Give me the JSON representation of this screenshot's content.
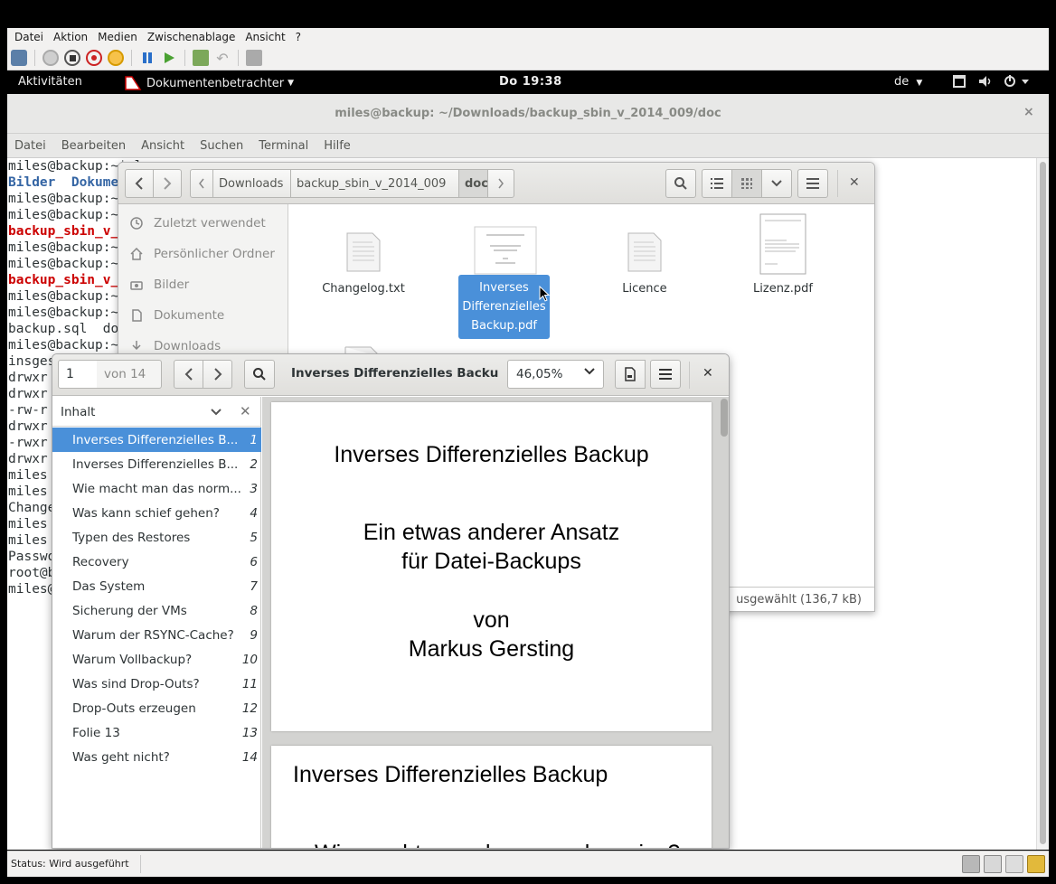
{
  "vbox": {
    "menu": [
      "Datei",
      "Aktion",
      "Medien",
      "Zwischenablage",
      "Ansicht",
      "?"
    ],
    "status": "Status: Wird ausgeführt"
  },
  "gnome": {
    "activities": "Aktivitäten",
    "app_menu": "Dokumentenbetrachter",
    "clock": "Do 19:38",
    "lang": "de"
  },
  "terminal": {
    "title": "miles@backup: ~/Downloads/backup_sbin_v_2014_009/doc",
    "close": "×",
    "menu": [
      "Datei",
      "Bearbeiten",
      "Ansicht",
      "Suchen",
      "Terminal",
      "Hilfe"
    ],
    "lines": [
      {
        "t": "miles@backup:~$ ls",
        "c": ""
      },
      {
        "t": "Bilder  Dokume",
        "c": "t-blue"
      },
      {
        "t": "miles@backup:~",
        "c": ""
      },
      {
        "t": "miles@backup:~",
        "c": ""
      },
      {
        "t": "backup_sbin_v_",
        "c": "t-red"
      },
      {
        "t": "miles@backup:~",
        "c": ""
      },
      {
        "t": "miles@backup:~",
        "c": ""
      },
      {
        "t": "backup_sbin_v_",
        "c": "t-red"
      },
      {
        "t": "miles@backup:~",
        "c": ""
      },
      {
        "t": "miles@backup:~",
        "c": ""
      },
      {
        "t": "backup.sql  do",
        "c": "mixed"
      },
      {
        "t": "miles@backup:~",
        "c": ""
      },
      {
        "t": "insges",
        "c": ""
      },
      {
        "t": "drwxr",
        "c": ""
      },
      {
        "t": "drwxr",
        "c": ""
      },
      {
        "t": "-rw-r",
        "c": ""
      },
      {
        "t": "drwxr",
        "c": ""
      },
      {
        "t": "-rwxr",
        "c": ""
      },
      {
        "t": "drwxr",
        "c": ""
      },
      {
        "t": "miles",
        "c": ""
      },
      {
        "t": "miles",
        "c": ""
      },
      {
        "t": "Change",
        "c": ""
      },
      {
        "t": "miles",
        "c": ""
      },
      {
        "t": "miles",
        "c": ""
      },
      {
        "t": "Passwo",
        "c": ""
      },
      {
        "t": "root@b",
        "c": ""
      },
      {
        "t": "miles@",
        "c": ""
      }
    ]
  },
  "files": {
    "path": [
      "Downloads",
      "backup_sbin_v_2014_009",
      "doc"
    ],
    "sidebar": [
      "Zuletzt verwendet",
      "Persönlicher Ordner",
      "Bilder",
      "Dokumente",
      "Downloads"
    ],
    "items": [
      {
        "name": "Changelog.txt"
      },
      {
        "name": "Inverses Differenzielles Backup.pdf"
      },
      {
        "name": "Licence"
      },
      {
        "name": "Lizenz.pdf"
      }
    ],
    "status": "usgewählt  (136,7 kB)"
  },
  "evince": {
    "page": "1",
    "of": "von 14",
    "title": "Inverses Differenzielles Backup...",
    "zoom": "46,05%",
    "sidebar_title": "Inhalt",
    "toc": [
      {
        "label": "Inverses Differenzielles B...",
        "page": "1"
      },
      {
        "label": "Inverses Differenzielles B...",
        "page": "2"
      },
      {
        "label": "Wie macht man das norm...",
        "page": "3"
      },
      {
        "label": "Was kann schief gehen?",
        "page": "4"
      },
      {
        "label": "Typen des Restores",
        "page": "5"
      },
      {
        "label": "Recovery",
        "page": "6"
      },
      {
        "label": "Das System",
        "page": "7"
      },
      {
        "label": "Sicherung der VMs",
        "page": "8"
      },
      {
        "label": "Warum der RSYNC-Cache?",
        "page": "9"
      },
      {
        "label": "Warum Vollbackup?",
        "page": "10"
      },
      {
        "label": "Was sind Drop-Outs?",
        "page": "11"
      },
      {
        "label": "Drop-Outs erzeugen",
        "page": "12"
      },
      {
        "label": "Folie 13",
        "page": "13"
      },
      {
        "label": "Was geht nicht?",
        "page": "14"
      }
    ],
    "page1": {
      "heading": "Inverses Differenzielles Backup",
      "sub1": "Ein etwas anderer Ansatz",
      "sub2": "für Datei-Backups",
      "by": "von",
      "author": "Markus Gersting"
    },
    "page2": {
      "heading": "Inverses Differenzielles Backup",
      "partial": "Wie macht man das normalerweise?"
    }
  }
}
